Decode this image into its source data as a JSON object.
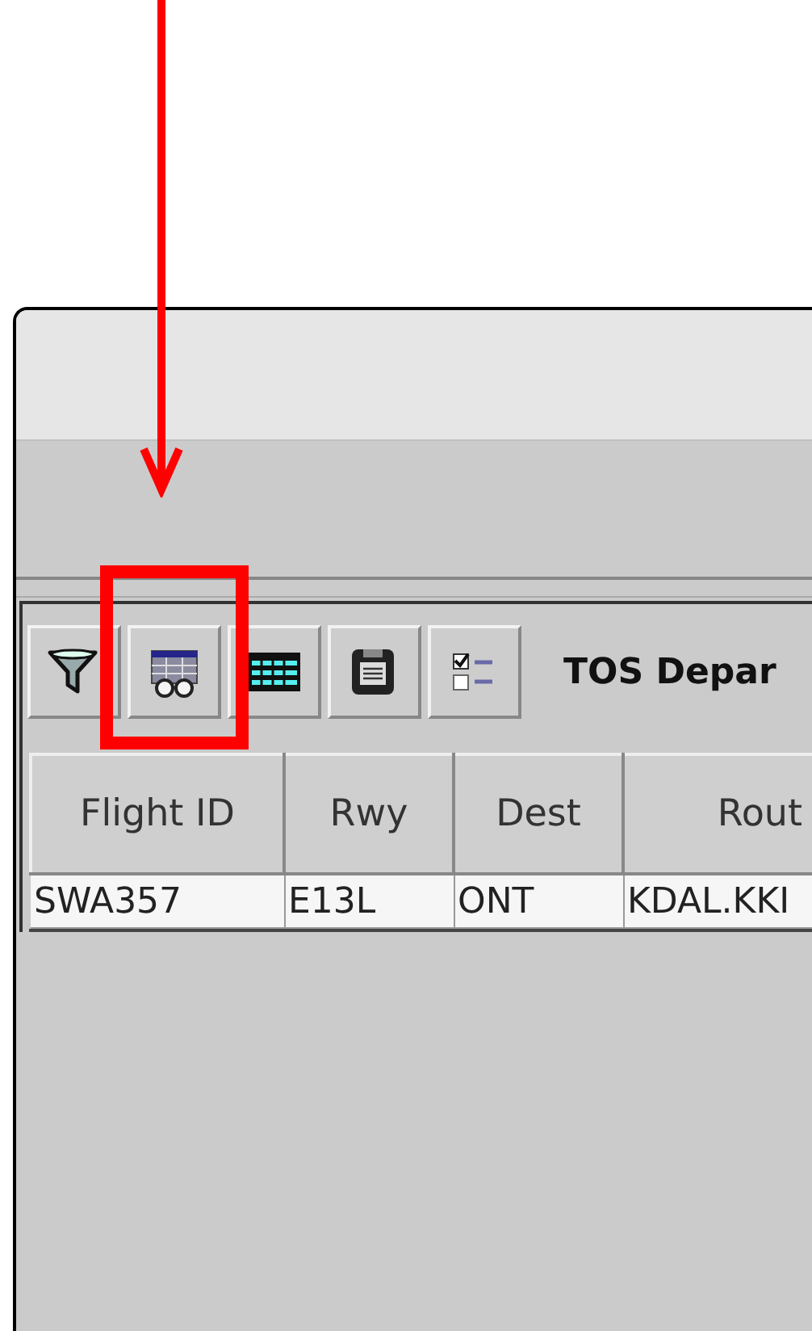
{
  "toolbar": {
    "buttons": [
      {
        "kind": "filter"
      },
      {
        "kind": "find"
      },
      {
        "kind": "grid"
      },
      {
        "kind": "save"
      },
      {
        "kind": "checklist"
      }
    ],
    "title": "TOS Depar"
  },
  "table": {
    "columns": [
      "Flight ID",
      "Rwy",
      "Dest",
      "Rout"
    ],
    "rows": [
      [
        "SWA357",
        "E13L",
        "ONT",
        "KDAL.KKI"
      ]
    ]
  }
}
